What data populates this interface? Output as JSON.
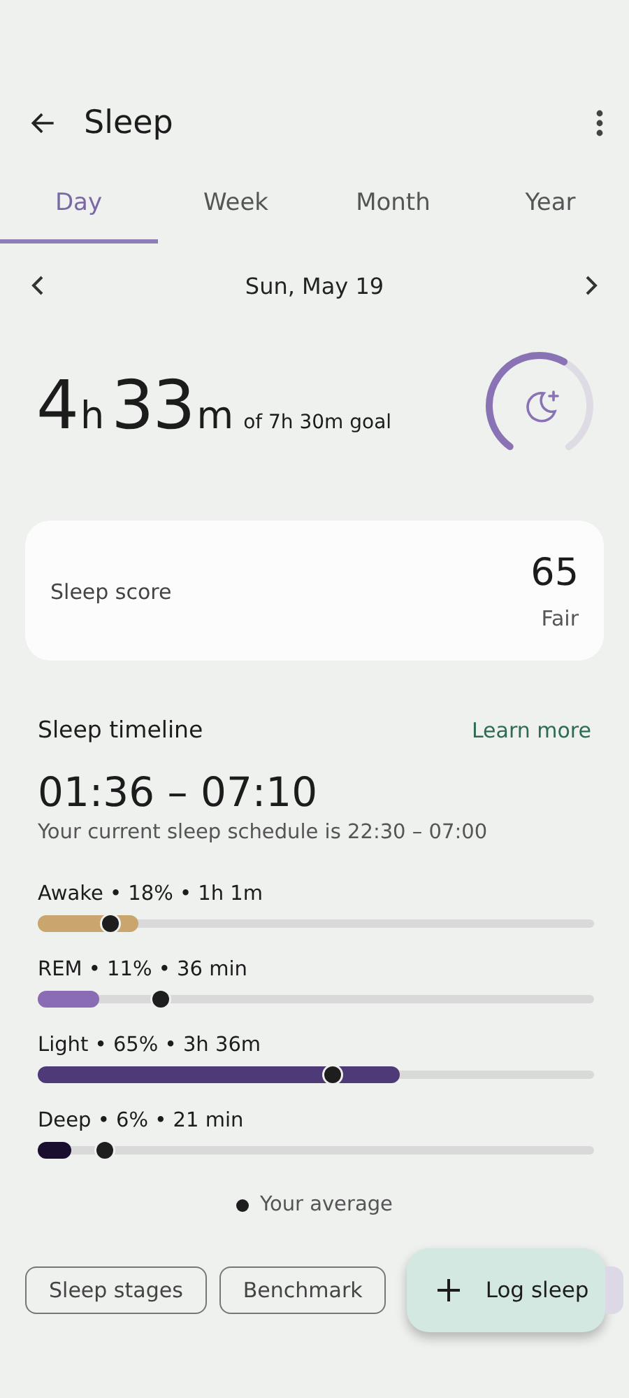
{
  "header": {
    "title": "Sleep"
  },
  "tabs": [
    {
      "label": "Day",
      "selected": true
    },
    {
      "label": "Week",
      "selected": false
    },
    {
      "label": "Month",
      "selected": false
    },
    {
      "label": "Year",
      "selected": false
    }
  ],
  "date": "Sun, May 19",
  "summary": {
    "hours": "4",
    "hours_unit": "h",
    "minutes": "33",
    "minutes_unit": "m",
    "goal": "of 7h 30m goal",
    "ring": {
      "level": 0.6
    }
  },
  "score_card": {
    "label": "Sleep score",
    "value": "65",
    "rating": "Fair"
  },
  "timeline": {
    "title": "Sleep timeline",
    "link": "Learn more",
    "range": "01:36 – 07:10",
    "schedule": "Your current sleep schedule is 22:30 – 07:00",
    "stages": [
      {
        "label": "Awake • 18% • 1h 1m",
        "color": "#c9a66e",
        "level": 0.18,
        "average": {
          "level": 0.13
        }
      },
      {
        "label": "REM • 11% • 36 min",
        "color": "#8a6cb4",
        "level": 0.11,
        "average": {
          "level": 0.22
        }
      },
      {
        "label": "Light • 65% • 3h 36m",
        "color": "#4f3a78",
        "level": 0.65,
        "average": {
          "level": 0.53
        }
      },
      {
        "label": "Deep • 6% • 21 min",
        "color": "#1a0f2e",
        "level": 0.06,
        "average": {
          "level": 0.12
        }
      }
    ],
    "legend": "Your average"
  },
  "chips": [
    "Sleep stages",
    "Benchmark"
  ],
  "fab": {
    "label": "Log sleep"
  }
}
